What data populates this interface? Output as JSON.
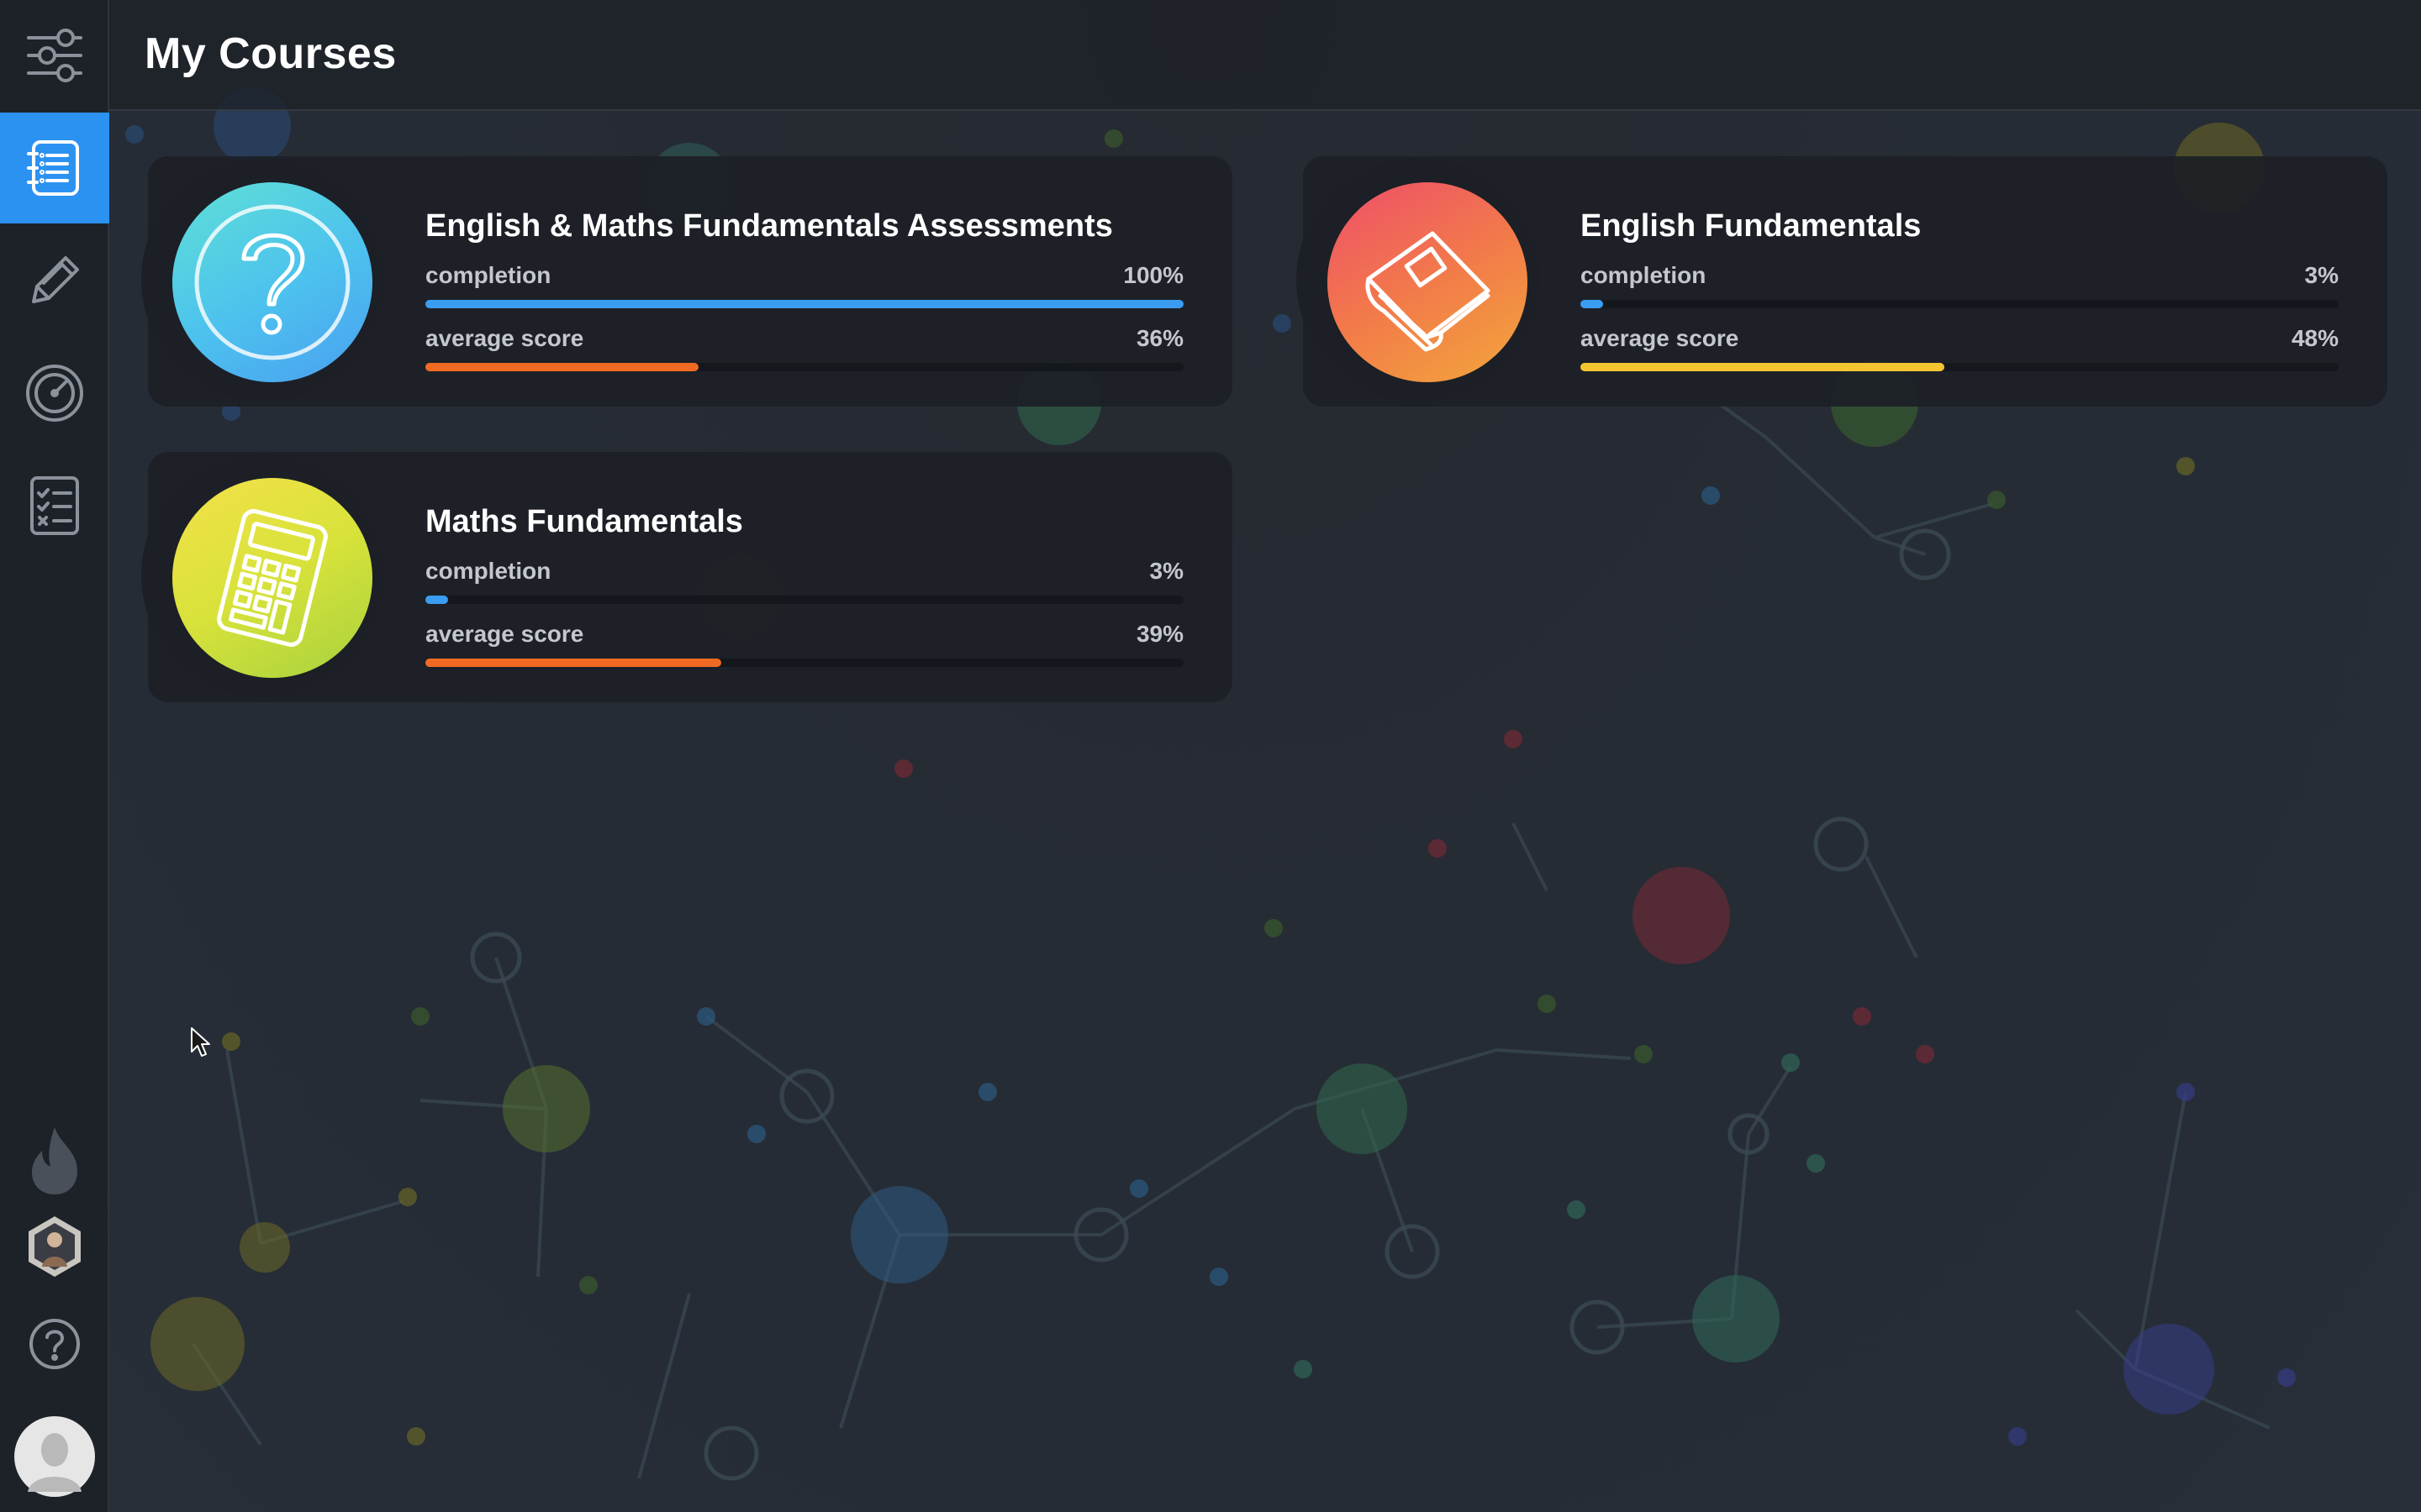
{
  "header": {
    "title": "My Courses"
  },
  "sidebar": {
    "items": [
      {
        "icon": "settings-sliders-icon",
        "active": false
      },
      {
        "icon": "course-list-icon",
        "active": true
      },
      {
        "icon": "pencil-icon",
        "active": false
      },
      {
        "icon": "gauge-icon",
        "active": false
      },
      {
        "icon": "checklist-icon",
        "active": false
      }
    ],
    "bottom": [
      {
        "icon": "flame-icon"
      },
      {
        "icon": "profile-hexagon-avatar"
      },
      {
        "icon": "help-icon"
      },
      {
        "icon": "user-avatar"
      }
    ]
  },
  "colors": {
    "accent": "#2c92f1",
    "completion_bar": "#3a9df2",
    "score_orange": "#f06a23",
    "score_yellow": "#f4c531"
  },
  "courses": [
    {
      "title": "English & Maths Fundamentals Assessments",
      "icon": "question-mark-icon",
      "completion_label": "completion",
      "completion_text": "100%",
      "completion": 100,
      "score_label": "average score",
      "score_text": "36%",
      "score": 36,
      "score_color": "#f06a23"
    },
    {
      "title": "English Fundamentals",
      "icon": "book-icon",
      "completion_label": "completion",
      "completion_text": "3%",
      "completion": 3,
      "score_label": "average score",
      "score_text": "48%",
      "score": 48,
      "score_color": "#f4c531"
    },
    {
      "title": "Maths Fundamentals",
      "icon": "calculator-icon",
      "completion_label": "completion",
      "completion_text": "3%",
      "completion": 3,
      "score_label": "average score",
      "score_text": "39%",
      "score": 39,
      "score_color": "#f06a23"
    }
  ]
}
